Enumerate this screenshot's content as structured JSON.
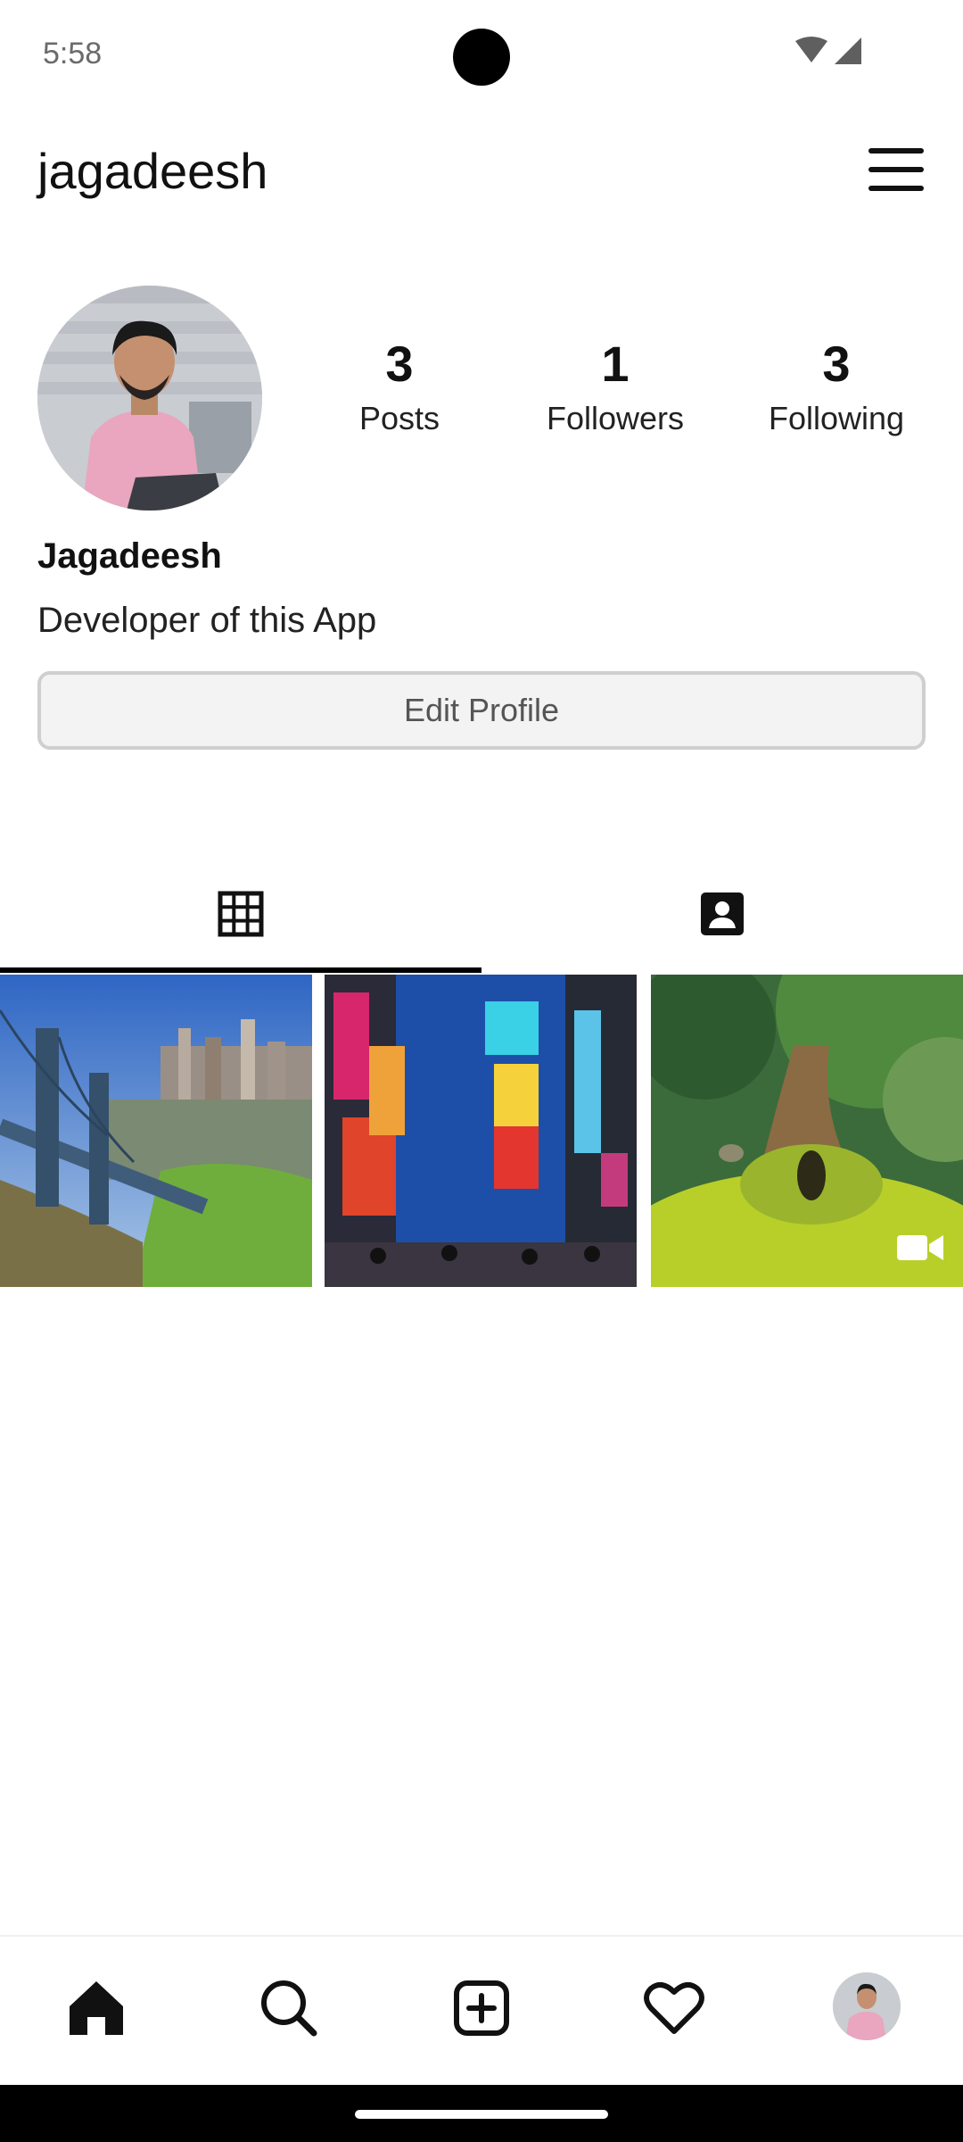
{
  "status_bar": {
    "time": "5:58",
    "icons": [
      "wifi-icon",
      "cell-signal-icon"
    ]
  },
  "header": {
    "username": "jagadeesh",
    "menu_icon": "hamburger-menu-icon"
  },
  "profile": {
    "display_name": "Jagadeesh",
    "bio": "Developer of this App",
    "stats": [
      {
        "count": "3",
        "label": "Posts"
      },
      {
        "count": "1",
        "label": "Followers"
      },
      {
        "count": "3",
        "label": "Following"
      }
    ],
    "edit_button_label": "Edit Profile"
  },
  "tabs": [
    {
      "icon": "grid-icon",
      "selected": true
    },
    {
      "icon": "tagged-contact-icon",
      "selected": false
    }
  ],
  "posts": [
    {
      "subject": "bridge-city",
      "type": "image"
    },
    {
      "subject": "times-square",
      "type": "image"
    },
    {
      "subject": "forest-tree",
      "type": "video"
    }
  ],
  "bottom_nav": [
    {
      "icon": "home-icon",
      "selected": true
    },
    {
      "icon": "search-icon",
      "selected": false
    },
    {
      "icon": "add-post-icon",
      "selected": false
    },
    {
      "icon": "heart-icon",
      "selected": false
    },
    {
      "icon": "profile-avatar",
      "selected": false
    }
  ],
  "colors": {
    "text": "#111111",
    "button_border": "#cfcfcf",
    "button_bg": "#f3f3f3",
    "tab_indicator": "#000000"
  }
}
